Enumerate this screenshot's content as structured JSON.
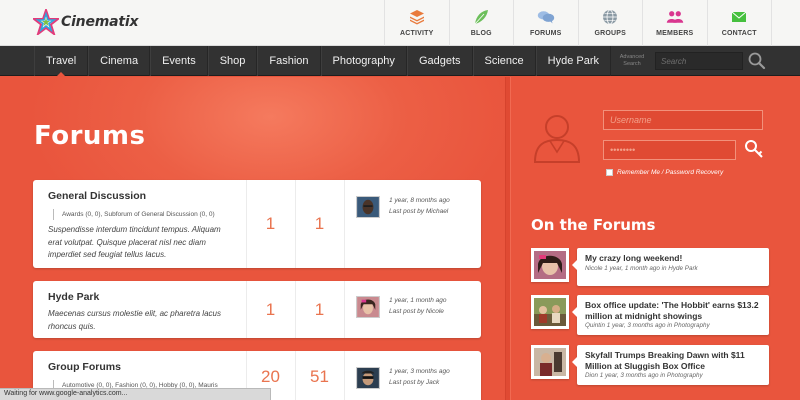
{
  "brand": {
    "name": "Cinematix"
  },
  "top_nav": [
    {
      "label": "ACTIVITY",
      "icon": "activity-stack-icon",
      "color": "#e97a3b"
    },
    {
      "label": "BLOG",
      "icon": "leaf-icon",
      "color": "#6cbf5a"
    },
    {
      "label": "FORUMS",
      "icon": "chat-bubbles-icon",
      "color": "#8fb0d9"
    },
    {
      "label": "GROUPS",
      "icon": "globe-icon",
      "color": "#7c8c96"
    },
    {
      "label": "MEMBERS",
      "icon": "members-icon",
      "color": "#d9368f"
    },
    {
      "label": "CONTACT",
      "icon": "envelope-icon",
      "color": "#46c03e"
    }
  ],
  "main_nav": [
    {
      "label": "Travel",
      "active": true
    },
    {
      "label": "Cinema"
    },
    {
      "label": "Events"
    },
    {
      "label": "Shop"
    },
    {
      "label": "Fashion"
    },
    {
      "label": "Photography"
    },
    {
      "label": "Gadgets"
    },
    {
      "label": "Science"
    },
    {
      "label": "Hyde Park"
    }
  ],
  "search": {
    "advanced_label_1": "Advanced",
    "advanced_label_2": "Search",
    "placeholder": "Search"
  },
  "page": {
    "title": "Forums"
  },
  "forums": [
    {
      "title": "General Discussion",
      "subforums": "Awards (0, 0), Subforum of General Discussion (0, 0)",
      "description": "Suspendisse interdum tincidunt tempus. Aliquam erat volutpat. Quisque placerat nisl nec diam imperdiet sed feugiat tellus lacus.",
      "topics": "1",
      "posts": "1",
      "last_time": "1 year, 8 months ago",
      "last_by": "Last post by Michael"
    },
    {
      "title": "Hyde Park",
      "subforums": "",
      "description": "Maecenas cursus molestie elit, ac pharetra lacus rhoncus quis.",
      "topics": "1",
      "posts": "1",
      "last_time": "1 year, 1 month ago",
      "last_by": "Last post by Nicole"
    },
    {
      "title": "Group Forums",
      "subforums": "Automotive (0, 0), Fashion (0, 0), Hobby (0, 0), Mauris",
      "description": "",
      "topics": "20",
      "posts": "51",
      "last_time": "1 year, 3 months ago",
      "last_by": "Last post by Jack"
    }
  ],
  "login": {
    "username_placeholder": "Username",
    "password_value": "••••••••",
    "remember": "Remember Me",
    "separator": " / ",
    "recovery": "Password Recovery"
  },
  "sidebar": {
    "title": "On the Forums",
    "items": [
      {
        "title": "My crazy long weekend!",
        "meta": "Nicole 1 year, 1 month ago in Hyde Park"
      },
      {
        "title": "Box office update: 'The Hobbit' earns $13.2 million at midnight showings",
        "meta": "Quintin 1 year, 3 months ago in Photography"
      },
      {
        "title": "Skyfall Trumps Breaking Dawn with $11 Million at Sluggish Box Office",
        "meta": "Dion 1 year, 3 months ago in Photography"
      }
    ]
  },
  "status_bar": {
    "text": "Waiting for www.google-analytics.com..."
  },
  "colors": {
    "accent": "#e9553d",
    "number": "#e9744f",
    "nav_dark": "#323232"
  }
}
